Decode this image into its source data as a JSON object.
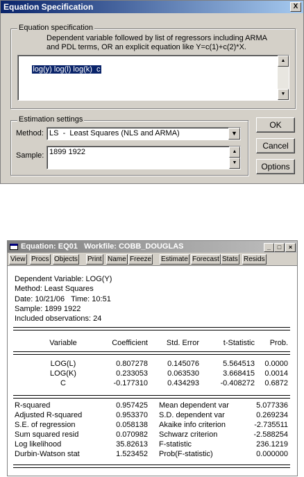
{
  "dialog": {
    "title": "Equation Specification",
    "close_label": "X",
    "spec_group": {
      "legend": "Equation specification",
      "hint_line1": "Dependent variable followed by list of regressors including ARMA",
      "hint_line2": "and PDL terms, OR an explicit equation like Y=c(1)+c(2)*X.",
      "equation_value": "log(y) log(l) log(k)  c"
    },
    "estimation_group": {
      "legend": "Estimation settings",
      "method_label": "Method:",
      "method_value": "LS  -  Least Squares (NLS and ARMA)",
      "sample_label": "Sample:",
      "sample_value": "1899 1922"
    },
    "buttons": {
      "ok": "OK",
      "cancel": "Cancel",
      "options": "Options"
    }
  },
  "output_window": {
    "title": "Equation: EQ01   Workfile: COBB_DOUGLAS",
    "toolbar": [
      "View",
      "Procs",
      "Objects",
      "Print",
      "Name",
      "Freeze",
      "Estimate",
      "Forecast",
      "Stats",
      "Resids"
    ],
    "header_lines": [
      "Dependent Variable: LOG(Y)",
      "Method: Least Squares",
      "Date: 10/21/06   Time: 10:51",
      "Sample: 1899 1922",
      "Included observations: 24"
    ],
    "columns": [
      "Variable",
      "Coefficient",
      "Std. Error",
      "t-Statistic",
      "Prob."
    ],
    "coef_rows": [
      [
        "LOG(L)",
        "0.807278",
        "0.145076",
        "5.564513",
        "0.0000"
      ],
      [
        "LOG(K)",
        "0.233053",
        "0.063530",
        "3.668415",
        "0.0014"
      ],
      [
        "C",
        "-0.177310",
        "0.434293",
        "-0.408272",
        "0.6872"
      ]
    ],
    "stats_rows": [
      [
        "R-squared",
        "0.957425",
        "Mean dependent var",
        "5.077336"
      ],
      [
        "Adjusted R-squared",
        "0.953370",
        "S.D. dependent var",
        "0.269234"
      ],
      [
        "S.E. of regression",
        "0.058138",
        "Akaike info criterion",
        "-2.735511"
      ],
      [
        "Sum squared resid",
        "0.070982",
        "Schwarz criterion",
        "-2.588254"
      ],
      [
        "Log likelihood",
        "35.82613",
        "F-statistic",
        "236.1219"
      ],
      [
        "Durbin-Watson stat",
        "1.523452",
        "Prob(F-statistic)",
        "0.000000"
      ]
    ]
  },
  "colors": {
    "title_active": "#0a246a",
    "face": "#d4d0c8"
  }
}
